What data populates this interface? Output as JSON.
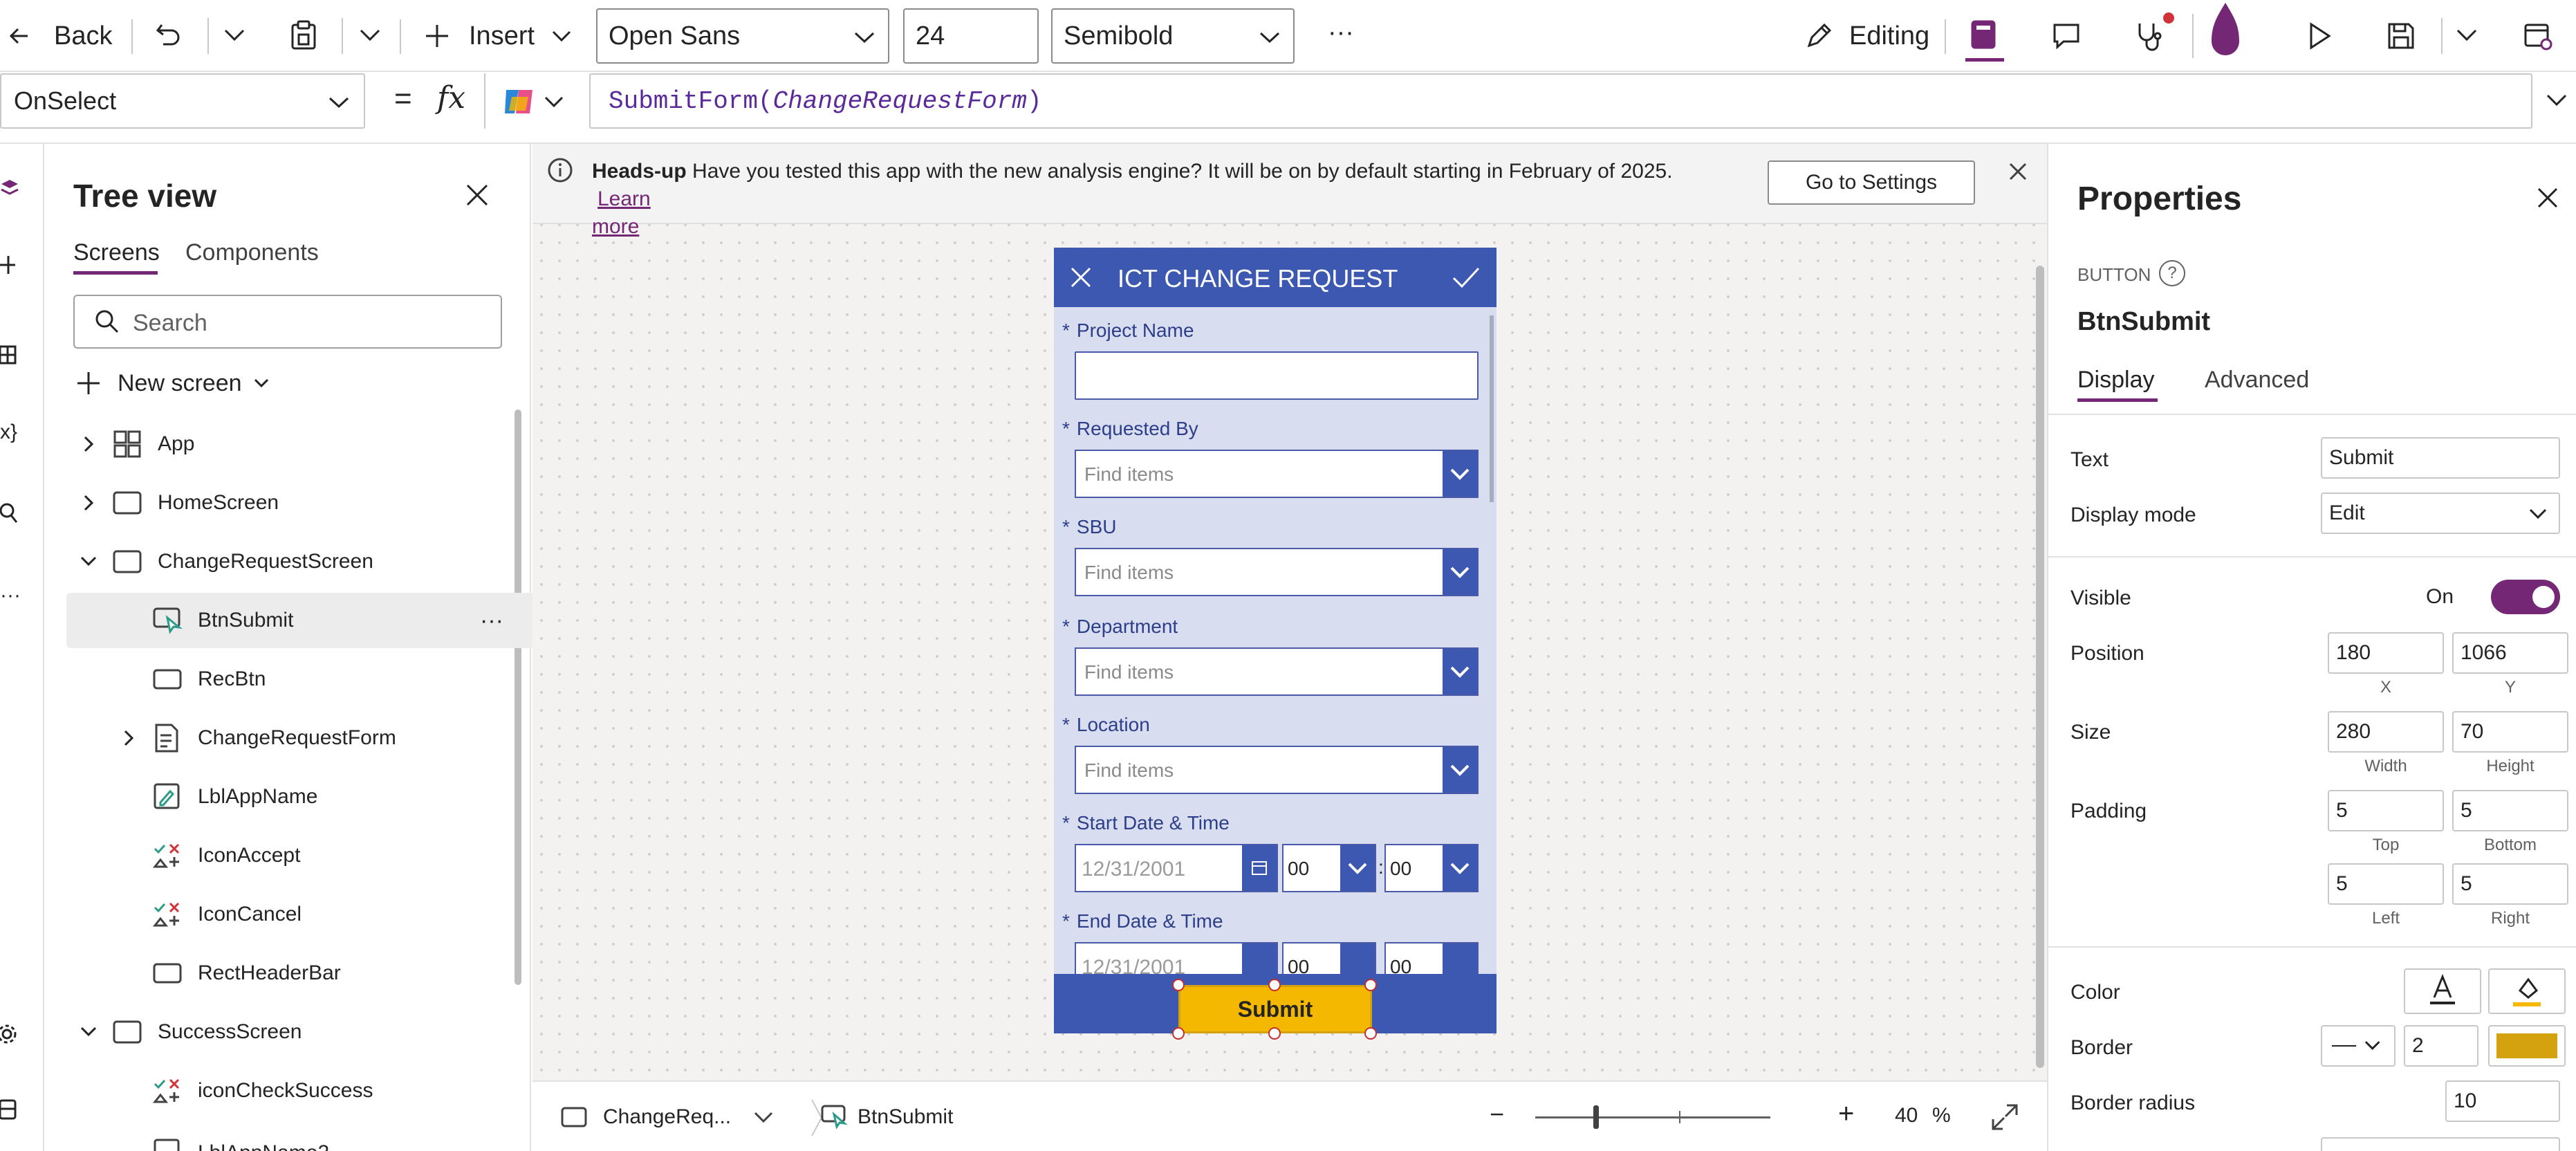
{
  "toolbar": {
    "back_label": "Back",
    "insert_label": "Insert",
    "font_value": "Open Sans",
    "size_value": "24",
    "weight_value": "Semibold",
    "more_label": "···",
    "editing_label": "Editing"
  },
  "formula": {
    "property": "OnSelect",
    "equals": "=",
    "fx": "fx",
    "fn": "SubmitForm(",
    "arg": "ChangeRequestForm",
    "close": ")"
  },
  "tree": {
    "title": "Tree view",
    "tabs": [
      "Screens",
      "Components"
    ],
    "search_placeholder": "Search",
    "new_screen": "New screen",
    "items": [
      {
        "label": "App"
      },
      {
        "label": "HomeScreen"
      },
      {
        "label": "ChangeRequestScreen"
      },
      {
        "label": "BtnSubmit"
      },
      {
        "label": "RecBtn"
      },
      {
        "label": "ChangeRequestForm"
      },
      {
        "label": "LblAppName"
      },
      {
        "label": "IconAccept"
      },
      {
        "label": "IconCancel"
      },
      {
        "label": "RectHeaderBar"
      },
      {
        "label": "SuccessScreen"
      },
      {
        "label": "iconCheckSuccess"
      },
      {
        "label": "LblAppName2"
      }
    ],
    "more_label": "···"
  },
  "headsup": {
    "bold": "Heads-up",
    "text": "Have you tested this app with the new analysis engine? It will be on by default starting in February of 2025.",
    "link1": "Learn",
    "link2": "more",
    "button": "Go to Settings"
  },
  "app": {
    "title": "ICT CHANGE REQUEST",
    "fields": [
      {
        "label": "Project Name"
      },
      {
        "label": "Requested By",
        "placeholder": "Find items"
      },
      {
        "label": "SBU",
        "placeholder": "Find items"
      },
      {
        "label": "Department",
        "placeholder": "Find items"
      },
      {
        "label": "Location",
        "placeholder": "Find items"
      },
      {
        "label": "Start Date & Time",
        "date": "12/31/2001",
        "hour": "00",
        "min": "00"
      },
      {
        "label": "End Date & Time",
        "date": "12/31/2001",
        "hour": "00",
        "min": "00"
      }
    ],
    "required_mark": "*",
    "colon": ":",
    "submit": "Submit"
  },
  "footer": {
    "screen": "ChangeReq...",
    "control": "BtnSubmit",
    "minus": "−",
    "plus": "+",
    "zoom": "40",
    "percent": "%"
  },
  "props": {
    "title": "Properties",
    "type": "BUTTON",
    "help": "?",
    "name": "BtnSubmit",
    "tabs": [
      "Display",
      "Advanced"
    ],
    "text_label": "Text",
    "text_value": "Submit",
    "display_mode_label": "Display mode",
    "display_mode_value": "Edit",
    "visible_label": "Visible",
    "visible_value": "On",
    "position_label": "Position",
    "pos_x": "180",
    "pos_y": "1066",
    "x_label": "X",
    "y_label": "Y",
    "size_label": "Size",
    "width": "280",
    "height": "70",
    "width_label": "Width",
    "height_label": "Height",
    "padding_label": "Padding",
    "pad_top": "5",
    "pad_bottom": "5",
    "pad_left": "5",
    "pad_right": "5",
    "top_label": "Top",
    "bottom_label": "Bottom",
    "left_label": "Left",
    "right_label": "Right",
    "color_label": "Color",
    "border_label": "Border",
    "border_width": "2",
    "border_radius_label": "Border radius",
    "border_radius_value": "10",
    "accent_color": "#742774",
    "button_fill": "#f5b800",
    "border_color": "#d4a20f"
  }
}
